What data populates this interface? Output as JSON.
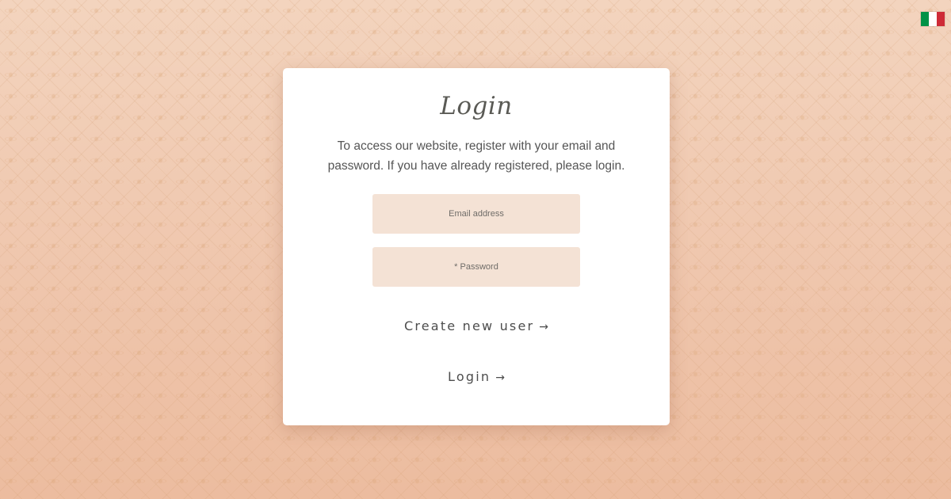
{
  "language_flag": {
    "icon": "italian-flag-icon",
    "colors": [
      "#009246",
      "#ffffff",
      "#ce2b37"
    ]
  },
  "login_card": {
    "title": "Login",
    "description": "To access our website, register with your email and password. If you have already registered, please login.",
    "email_field": {
      "placeholder": "Email address",
      "value": ""
    },
    "password_field": {
      "placeholder": "* Password",
      "value": ""
    },
    "create_user_label": "Create new user",
    "login_label": "Login",
    "arrow_glyph": "→"
  },
  "colors": {
    "background": "#efc9b0",
    "input_fill": "#f4e2d5",
    "text": "#555555"
  }
}
